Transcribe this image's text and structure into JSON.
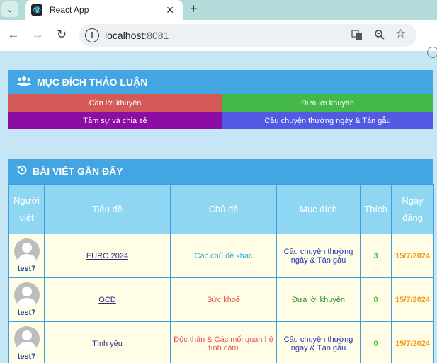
{
  "browser": {
    "tab_title": "React App",
    "url_host": "localhost",
    "url_port": ":8081"
  },
  "purpose_section": {
    "title": "MỤC ĐÍCH THẢO LUẬN",
    "buttons": [
      {
        "label": "Cần lời khuyên",
        "color": "#d45a57"
      },
      {
        "label": "Đưa lời khuyên",
        "color": "#44b849"
      },
      {
        "label": "Tâm sự và chia sẻ",
        "color": "#8b0da3"
      },
      {
        "label": "Câu chuyện thường ngày & Tán gẫu",
        "color": "#5259e2"
      }
    ]
  },
  "recent_section": {
    "title": "BÀI VIẾT GẦN ĐÂY",
    "headers": {
      "author": "Người viết",
      "title": "Tiêu đề",
      "topic": "Chủ đề",
      "purpose": "Mục đích",
      "likes": "Thích",
      "date": "Ngày đăng"
    },
    "rows": [
      {
        "author": "test7",
        "title": "EURO 2024",
        "topic": "Các chủ đề khác",
        "topic_color": "#2aa8e0",
        "purpose": "Câu chuyện thường ngày & Tán gẫu",
        "purpose_color": "#2233bb",
        "likes": "3",
        "date": "15/7/2024"
      },
      {
        "author": "test7",
        "title": "OCD",
        "topic": "Sức khoẻ",
        "topic_color": "#e05555",
        "purpose": "Đưa lời khuyên",
        "purpose_color": "#1e8a2a",
        "likes": "0",
        "date": "15/7/2024"
      },
      {
        "author": "test7",
        "title": "Tình yêu",
        "topic": "Độc thân & Các mối quan hệ tình cảm",
        "topic_color": "#e05555",
        "purpose": "Câu chuyện thường ngày & Tán gẫu",
        "purpose_color": "#2233bb",
        "likes": "0",
        "date": "15/7/2024"
      }
    ]
  }
}
